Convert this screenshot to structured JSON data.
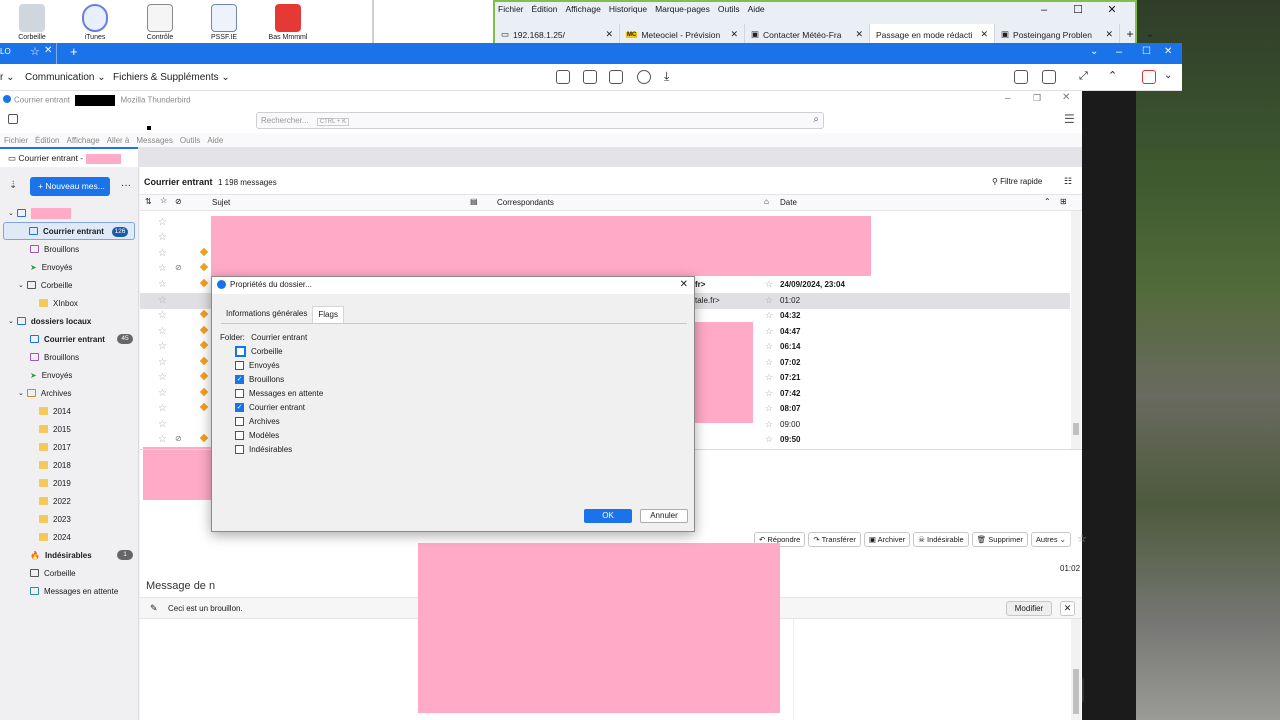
{
  "desktop": {
    "icons": [
      "Corbeille",
      "iTunes",
      "Contrôle",
      "PSSF.IE",
      "Bas Mmmml"
    ]
  },
  "firefox": {
    "menu": [
      "Fichier",
      "Édition",
      "Affichage",
      "Historique",
      "Marque-pages",
      "Outils",
      "Aide"
    ],
    "tabs": [
      "192.168.1.25/",
      "Meteociel - Prévision",
      "Contacter Météo-Fra",
      "Passage en mode rédacti",
      "Posteingang Problen"
    ],
    "controls": {
      "min": "–",
      "max": "☐",
      "close": "✕",
      "new_tab": "+",
      "list": "⌄"
    }
  },
  "browser2": {
    "left_label": "LO",
    "menu": [
      "Communication",
      "Fichiers & Suppléments"
    ]
  },
  "thunderbird": {
    "title_prefix": "Courrier entrant",
    "title_suffix": "Mozilla Thunderbird",
    "search_placeholder": "Rechercher...",
    "search_shortcut": "CTRL + K",
    "menu": [
      "Fichier",
      "Édition",
      "Affichage",
      "Aller à",
      "Messages",
      "Outils",
      "Aide"
    ],
    "tab_label": "Courrier entrant -",
    "new_message": "+ Nouveau mes...",
    "folders": [
      {
        "name": "Courrier entrant",
        "count": "126"
      },
      {
        "name": "Brouillons"
      },
      {
        "name": "Envoyés"
      },
      {
        "name": "Corbeille"
      },
      {
        "name": "XInbox"
      },
      {
        "name": "dossiers locaux"
      },
      {
        "name": "Courrier entrant",
        "count": "45"
      },
      {
        "name": "Brouillons"
      },
      {
        "name": "Envoyés"
      },
      {
        "name": "Archives"
      },
      {
        "name": "2014"
      },
      {
        "name": "2015"
      },
      {
        "name": "2017"
      },
      {
        "name": "2018"
      },
      {
        "name": "2019"
      },
      {
        "name": "2022"
      },
      {
        "name": "2023"
      },
      {
        "name": "2024"
      },
      {
        "name": "Indésirables",
        "count": "1"
      },
      {
        "name": "Corbeille"
      },
      {
        "name": "Messages en attente"
      }
    ],
    "list_folder": "Courrier entrant",
    "list_count": "1 198 messages",
    "quick_filter": "Filtre rapide",
    "columns": {
      "subject": "Sujet",
      "correspondents": "Correspondants",
      "date": "Date"
    },
    "rows": [
      {
        "sender": "fr>",
        "date": "24/09/2024, 23:04",
        "bold": true
      },
      {
        "sender": "tale.fr>",
        "date": "01:02",
        "bold": false
      },
      {
        "date": "04:32",
        "bold": true
      },
      {
        "date": "04:47",
        "bold": true
      },
      {
        "date": "06:14",
        "bold": true
      },
      {
        "date": "07:02",
        "bold": true
      },
      {
        "date": "07:21",
        "bold": true
      },
      {
        "date": "07:42",
        "bold": true
      },
      {
        "date": "08:07",
        "bold": true
      },
      {
        "date": "09:00",
        "bold": false
      },
      {
        "date": "09:50",
        "bold": true
      }
    ],
    "actions": [
      "Répondre",
      "Transférer",
      "Archiver",
      "Indésirable",
      "Supprimer",
      "Autres"
    ],
    "preview_time": "01:02",
    "message_prefix": "Message de n",
    "draft_notice": "Ceci est un brouillon.",
    "modify_button": "Modifier"
  },
  "dialog": {
    "title": "Propriétés du dossier...",
    "tabs": [
      "Informations générales",
      "Flags"
    ],
    "folder_label": "Folder:",
    "folder_value": "Courrier entrant",
    "flags": [
      {
        "label": "Corbeille",
        "checked": false
      },
      {
        "label": "Envoyés",
        "checked": false
      },
      {
        "label": "Brouillons",
        "checked": true
      },
      {
        "label": "Messages en attente",
        "checked": false
      },
      {
        "label": "Courrier entrant",
        "checked": true
      },
      {
        "label": "Archives",
        "checked": false
      },
      {
        "label": "Modèles",
        "checked": false
      },
      {
        "label": "Indésirables",
        "checked": false
      }
    ],
    "ok": "OK",
    "cancel": "Annuler",
    "close": "✕"
  },
  "colors": {
    "accent": "#1a73e8",
    "redacted": "#ffabc7",
    "unread_badge": "#1a5aa8"
  }
}
